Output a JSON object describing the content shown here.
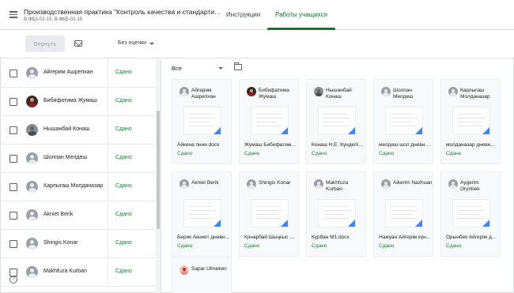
{
  "header": {
    "course_title": "Производственная практика \"Контроль качества и стандартизация...",
    "course_groups": "В-ФҚА-02-15, В-ФҚБ-02-15",
    "tabs": [
      {
        "label": "Инструкции",
        "active": false
      },
      {
        "label": "Работы учащихся",
        "active": true
      }
    ]
  },
  "toolbar": {
    "return_label": "Вернуть",
    "grade_filter": "Без оценки"
  },
  "filter": {
    "label": "Все"
  },
  "help_label": "?",
  "students": [
    {
      "name": "Айгерим Ашрепхан",
      "status": "Сдано",
      "avatar": "default"
    },
    {
      "name": "Бибифатима Жумаш",
      "status": "Сдано",
      "avatar": "photo-f"
    },
    {
      "name": "Нышанбай Конаш",
      "status": "Сдано",
      "avatar": "photo-m"
    },
    {
      "name": "Шолпан Мелдеш",
      "status": "Сдано",
      "avatar": "default"
    },
    {
      "name": "Карлыгаш Молданазар",
      "status": "Сдано",
      "avatar": "default"
    },
    {
      "name": "Akniet Berik",
      "status": "Сдано",
      "avatar": "default"
    },
    {
      "name": "Shingis Konar",
      "status": "Сдано",
      "avatar": "default"
    },
    {
      "name": "Makhfuza Kurban",
      "status": "Сдано",
      "avatar": "default"
    }
  ],
  "cards": [
    {
      "name": "Айгерим Ашрепхан",
      "file": "Айкена пнни.docx",
      "status": "Сдано",
      "avatar": "default"
    },
    {
      "name": "Бибифатима Жумаш",
      "file": "Жумаш Бибифатима...",
      "status": "Сдано",
      "avatar": "photo-f"
    },
    {
      "name": "Нышанбай Конаш",
      "file": "Конаш Н.Е. Күнделік ...",
      "status": "Сдано",
      "avatar": "photo-m"
    },
    {
      "name": "Шолпан Мелдеш",
      "file": "мелдеш шол дневни...",
      "status": "Сдано",
      "avatar": "default"
    },
    {
      "name": "Карлыгаш Молданазар",
      "file": "молданазар дневник...",
      "status": "Сдано",
      "avatar": "default"
    },
    {
      "name": "Akniet Berik",
      "file": "Берик Акниет дневн...",
      "status": "Сдано",
      "avatar": "default"
    },
    {
      "name": "Shingis Konar",
      "file": "Қонарбай Шыңғыс З...",
      "status": "Сдано",
      "avatar": "default"
    },
    {
      "name": "Makhfuza Kurban",
      "file": "Курбан М1.docx",
      "status": "Сдано",
      "avatar": "default"
    },
    {
      "name": "Aikerim Nazhuan",
      "file": "Нажуан Айгерім күн...",
      "status": "Сдано",
      "avatar": "default"
    },
    {
      "name": "Aygerim Orynbek",
      "file": "Орынбек Айгерім дн...",
      "status": "Сдано",
      "avatar": "default"
    },
    {
      "name": "Sapar Ulmeken",
      "file": "",
      "status": "",
      "avatar": "photo-r"
    }
  ],
  "icons": {
    "menu": "menu-icon",
    "mail": "mail-icon",
    "folder": "folder-icon",
    "help": "help-icon"
  },
  "colors": {
    "accent": "#137333",
    "status": "#188038",
    "doc_fold": "#4285f4"
  }
}
